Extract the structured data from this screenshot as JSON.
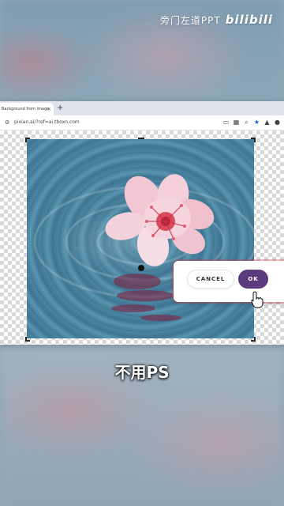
{
  "watermark": {
    "channel": "旁门左道PPT",
    "logo_text": "bilibili"
  },
  "browser": {
    "tab_title": "Background from image",
    "new_tab_label": "+",
    "tab_close": "×",
    "url": "pixian.ai/?ref=ai.tboxn.com",
    "address_icons": [
      "cast-icon",
      "translate-icon",
      "zoom-icon",
      "bookmark-star-icon",
      "extension-icon",
      "profile-icon"
    ]
  },
  "dialog": {
    "cancel_label": "CANCEL",
    "ok_label": "OK",
    "ok_color": "#5c3a7e"
  },
  "caption": "不用PS"
}
